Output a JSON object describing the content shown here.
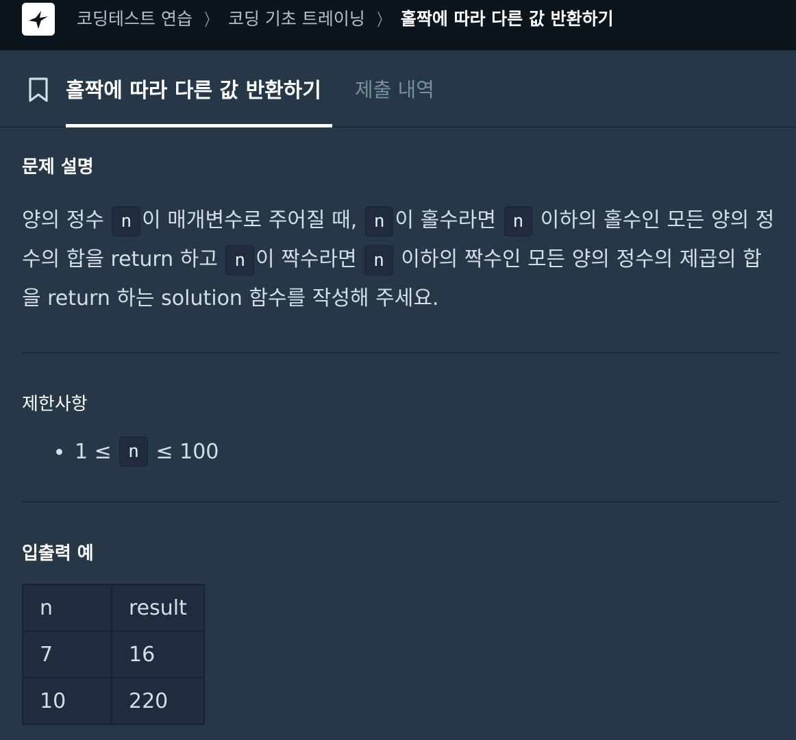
{
  "header": {
    "breadcrumbs": [
      "코딩테스트 연습",
      "코딩 기초 트레이닝",
      "홀짝에 따라 다른 값 반환하기"
    ],
    "separator": "〉"
  },
  "tabs": {
    "active_label": "홀짝에 따라 다른 값 반환하기",
    "inactive_label": "제출 내역"
  },
  "problem": {
    "description_title": "문제 설명",
    "desc": {
      "p1": "양의 정수 ",
      "code1": "n",
      "p2": "이 매개변수로 주어질 때, ",
      "code2": "n",
      "p3": "이 홀수라면 ",
      "code3": "n",
      "p4": " 이하의 홀수인 모든 양의 정수의 합을 return 하고 ",
      "code4": "n",
      "p5": "이 짝수라면 ",
      "code5": "n",
      "p6": " 이하의 짝수인 모든 양의 정수의 제곱의 합을 return 하는 solution 함수를 작성해 주세요."
    },
    "constraints_title": "제한사항",
    "constraint": {
      "pre": "1 ≤ ",
      "code": "n",
      "post": " ≤ 100"
    },
    "io_title": "입출력 예",
    "io_table": {
      "headers": [
        "n",
        "result"
      ],
      "rows": [
        [
          "7",
          "16"
        ],
        [
          "10",
          "220"
        ]
      ]
    }
  },
  "colors": {
    "background": "#263747",
    "topbar": "#0c151c",
    "code_bg": "#202b3d",
    "inactive_tab": "#78909c"
  }
}
